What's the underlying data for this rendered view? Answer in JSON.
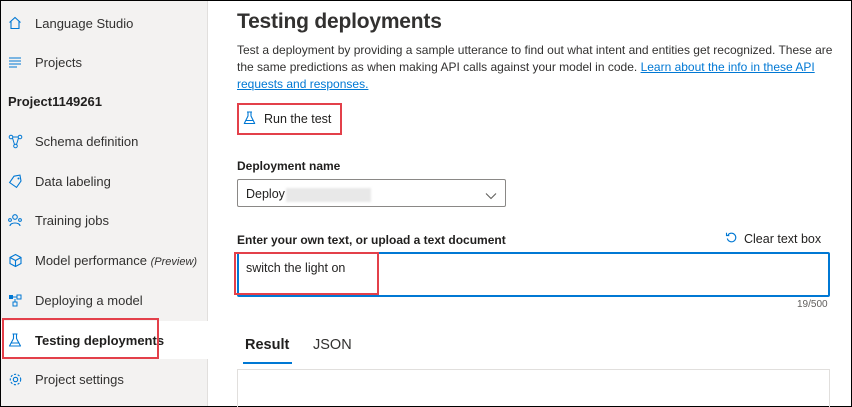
{
  "sidebar": {
    "items": [
      {
        "label": "Language Studio",
        "icon": "home-icon"
      },
      {
        "label": "Projects",
        "icon": "list-icon"
      },
      {
        "label": "Schema definition",
        "icon": "schema-icon"
      },
      {
        "label": "Data labeling",
        "icon": "tag-icon"
      },
      {
        "label": "Training jobs",
        "icon": "training-icon"
      },
      {
        "label": "Model performance",
        "suffix": "(Preview)",
        "icon": "cube-icon"
      },
      {
        "label": "Deploying a model",
        "icon": "deploy-icon"
      },
      {
        "label": "Testing deployments",
        "icon": "beaker-icon",
        "active": true
      },
      {
        "label": "Project settings",
        "icon": "gear-icon"
      }
    ],
    "project_name": "Project1149261"
  },
  "main": {
    "title": "Testing deployments",
    "description": "Test a deployment by providing a sample utterance to find out what intent and entities get recognized. These are the same predictions as when making API calls against your model in code.",
    "description_link": "Learn about the info in these API requests and responses.",
    "run_test_label": "Run the test",
    "deployment_label": "Deployment name",
    "deployment_value": "Deploy",
    "text_label": "Enter your own text, or upload a text document",
    "clear_label": "Clear text box",
    "text_value": "switch the light on",
    "char_count": "19/500",
    "tabs": [
      {
        "label": "Result",
        "active": true
      },
      {
        "label": "JSON",
        "active": false
      }
    ]
  },
  "colors": {
    "accent": "#0078d4",
    "highlight": "#e3404a",
    "sidebar_bg": "#f3f2f1"
  }
}
